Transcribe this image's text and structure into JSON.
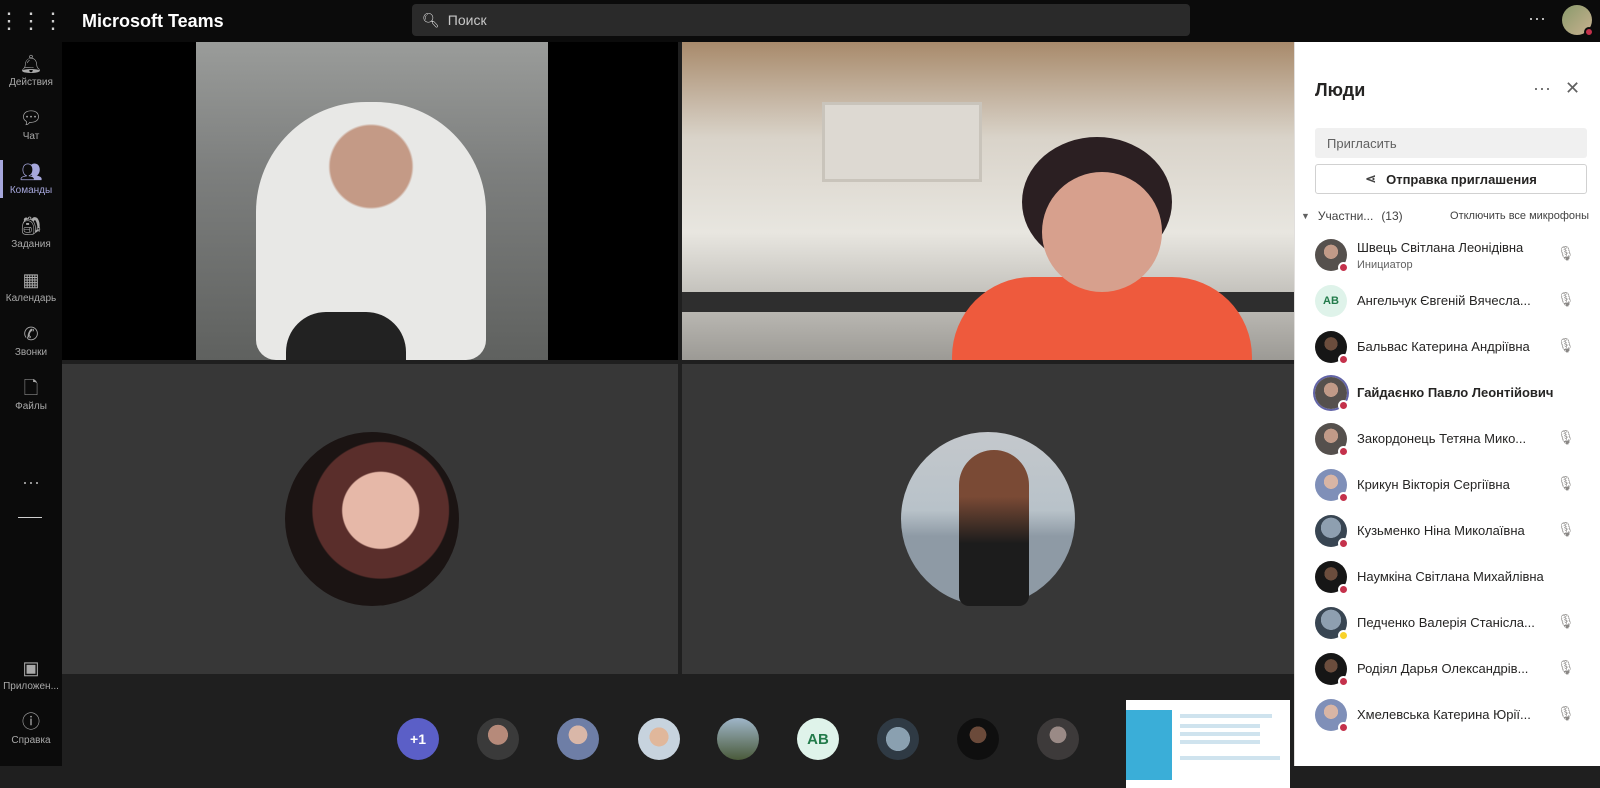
{
  "topbar": {
    "app_title": "Microsoft Teams",
    "search_placeholder": "Поиск"
  },
  "rail": {
    "items": [
      {
        "label": "Действия",
        "icon": "bell-icon"
      },
      {
        "label": "Чат",
        "icon": "chat-icon"
      },
      {
        "label": "Команды",
        "icon": "teams-icon",
        "active": true
      },
      {
        "label": "Задания",
        "icon": "assignments-icon"
      },
      {
        "label": "Календарь",
        "icon": "calendar-icon"
      },
      {
        "label": "Звонки",
        "icon": "phone-icon"
      },
      {
        "label": "Файлы",
        "icon": "file-icon"
      }
    ],
    "bottom_items": [
      {
        "label": "Приложен...",
        "icon": "apps-icon"
      },
      {
        "label": "Справка",
        "icon": "help-icon"
      }
    ]
  },
  "strip": {
    "overflow_label": "+1",
    "initials_chip": "AB"
  },
  "panel": {
    "title": "Люди",
    "invite_placeholder": "Пригласить",
    "invite_button": "Отправка приглашения",
    "section_label": "Участни...",
    "section_count": "(13)",
    "mute_all": "Отключить все микрофоны",
    "participants": [
      {
        "name": "Швець Світлана Леонідівна",
        "role": "Инициатор",
        "muted": true
      },
      {
        "name": "Ангельчук Євгеній Вячесла...",
        "initials": "AB",
        "muted": true
      },
      {
        "name": "Бальвас Катерина Андріївна",
        "muted": true
      },
      {
        "name": "Гайдаєнко Павло Леонтійович",
        "speaking": true
      },
      {
        "name": "Закордонець Тетяна Мико...",
        "muted": true
      },
      {
        "name": "Крикун Вікторія Сергіївна",
        "muted": true
      },
      {
        "name": "Кузьменко Ніна Миколаївна",
        "muted": true
      },
      {
        "name": "Наумкіна Світлана Михайлівна"
      },
      {
        "name": "Педченко Валерія Станісла...",
        "muted": true,
        "status": "away"
      },
      {
        "name": "Родіял Дарья Олександрів...",
        "muted": true
      },
      {
        "name": "Хмелевська Катерина Юрії...",
        "muted": true
      }
    ]
  },
  "colors": {
    "accent": "#6264a7",
    "busy": "#c4314b",
    "away": "#f8d22a"
  }
}
